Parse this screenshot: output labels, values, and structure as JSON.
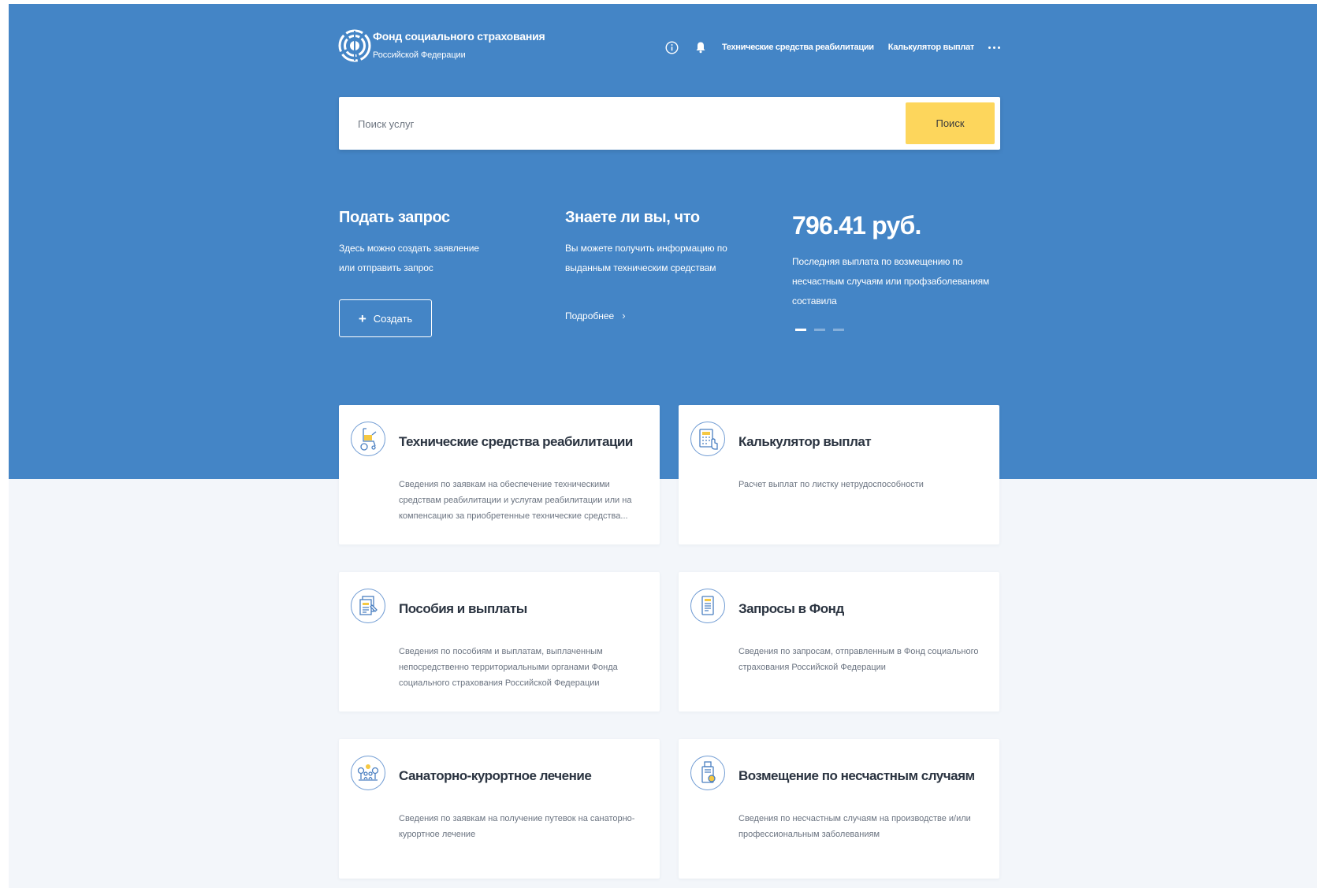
{
  "colors": {
    "hero_blue": "#4485c6",
    "page_background": "#f3f6fa",
    "search_button": "#fdd65c",
    "card_background": "#ffffff",
    "icon_stroke": "#4a7fc1"
  },
  "header": {
    "logo_icon": "fss-logo",
    "org_title": "Фонд социального страхования",
    "org_subtitle": "Российской Федерации",
    "nav": {
      "info_icon": "info-icon",
      "notifications_icon": "bell-icon",
      "links": [
        "Технические средства реабилитации",
        "Калькулятор выплат"
      ],
      "more_icon": "more-icon"
    }
  },
  "search": {
    "placeholder": "Поиск услуг",
    "value": "",
    "button_label": "Поиск"
  },
  "promo": {
    "request": {
      "title": "Подать запрос",
      "lines": [
        "Здесь можно создать заявление",
        "или отправить запрос"
      ],
      "button_icon": "plus-icon",
      "button_label": "Создать"
    },
    "did_you_know": {
      "title": "Знаете ли вы, что",
      "lines": [
        "Вы можете получить информацию по",
        "выданным техническим средствам"
      ],
      "link_label": "Подробнее",
      "link_icon": "chevron-right-icon"
    },
    "last_payment": {
      "amount": "796.41 руб.",
      "lines": [
        "Последняя выплата по возмещению по",
        "несчастным случаям или профзаболеваниям",
        "составила"
      ],
      "carousel_total": 3,
      "carousel_active": 1
    }
  },
  "cards": [
    {
      "icon": "wheelchair-icon",
      "title": "Технические средства реабилитации",
      "description": [
        "Сведения по заявкам на обеспечение техническими",
        "средствам реабилитации и услугам реабилитации или на",
        "компенсацию за приобретенные технические средства..."
      ]
    },
    {
      "icon": "calculator-icon",
      "title": "Калькулятор выплат",
      "description": [
        "Расчет выплат по листку нетрудоспособности"
      ]
    },
    {
      "icon": "documents-icon",
      "title": "Пособия и выплаты",
      "description": [
        "Сведения по пособиям и выплатам, выплаченным",
        "непосредственно территориальными органами Фонда",
        "социального страхования Российской Федерации"
      ]
    },
    {
      "icon": "request-document-icon",
      "title": "Запросы в Фонд",
      "description": [
        "Сведения по запросам, отправленным в Фонд социального",
        "страхования Российской Федерации"
      ]
    },
    {
      "icon": "sanatorium-icon",
      "title": "Санаторно-курортное лечение",
      "description": [
        "Сведения по заявкам на получение путевок на санаторно-",
        "курортное лечение"
      ]
    },
    {
      "icon": "compensation-icon",
      "title": "Возмещение по несчастным случаям",
      "description": [
        "Сведения по несчастным случаям на производстве и/или",
        "профессиональным заболеваниям"
      ]
    }
  ]
}
